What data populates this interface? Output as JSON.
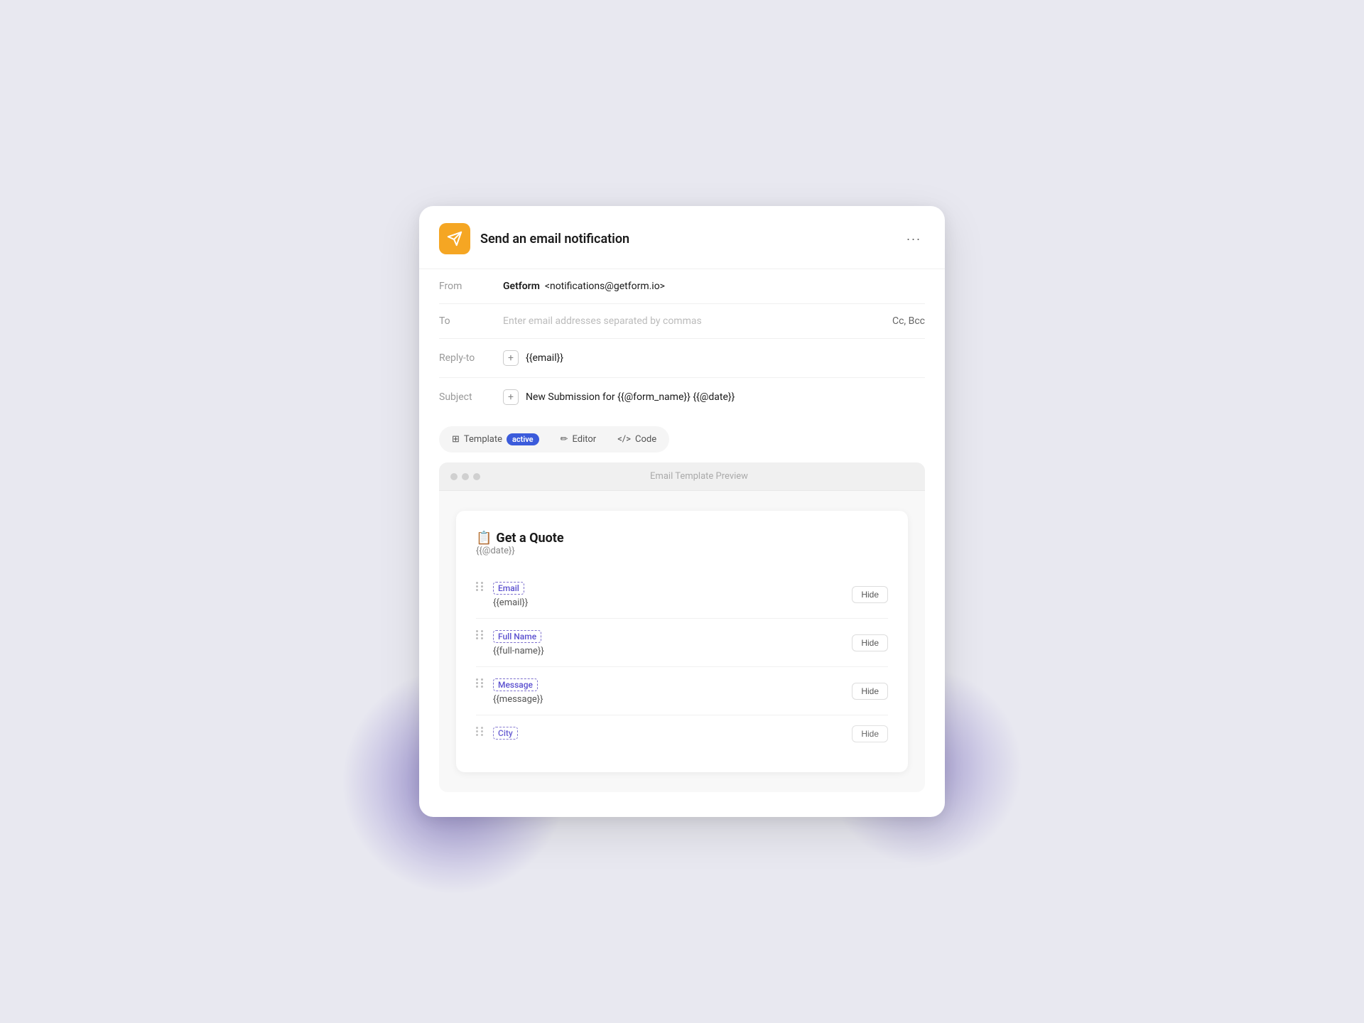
{
  "background": {
    "blob_left": "decorative",
    "blob_right": "decorative"
  },
  "modal": {
    "header": {
      "app_icon_alt": "send-email-icon",
      "title": "Send an email notification",
      "more_icon": "ellipsis-icon"
    },
    "from_row": {
      "label": "From",
      "sender_name": "Getform",
      "sender_email": "<notifications@getform.io>"
    },
    "to_row": {
      "label": "To",
      "placeholder": "Enter email addresses separated by commas",
      "cc_bcc": "Cc, Bcc"
    },
    "reply_to_row": {
      "label": "Reply-to",
      "plus_icon": "+",
      "value": "{{email}}"
    },
    "subject_row": {
      "label": "Subject",
      "plus_icon": "+",
      "value": "New Submission for {{@form_name}} {{@date}}"
    },
    "tabs": [
      {
        "id": "template",
        "icon": "grid-icon",
        "label": "Template",
        "badge": "active",
        "is_active": true
      },
      {
        "id": "editor",
        "icon": "pencil-icon",
        "label": "Editor",
        "is_active": false
      },
      {
        "id": "code",
        "icon": "code-icon",
        "label": "Code",
        "is_active": false
      }
    ],
    "preview": {
      "header_title": "Email Template Preview",
      "dots": [
        "dot1",
        "dot2",
        "dot3"
      ],
      "email_card": {
        "form_emoji": "📋",
        "form_title": "Get a Quote",
        "form_date_var": "{{@date}}",
        "fields": [
          {
            "tag_label": "Email",
            "var_value": "{{email}}",
            "hide_label": "Hide"
          },
          {
            "tag_label": "Full Name",
            "var_value": "{{full-name}}",
            "hide_label": "Hide"
          },
          {
            "tag_label": "Message",
            "var_value": "{{message}}",
            "hide_label": "Hide"
          },
          {
            "tag_label": "City",
            "var_value": "",
            "hide_label": "Hide"
          }
        ]
      }
    }
  }
}
